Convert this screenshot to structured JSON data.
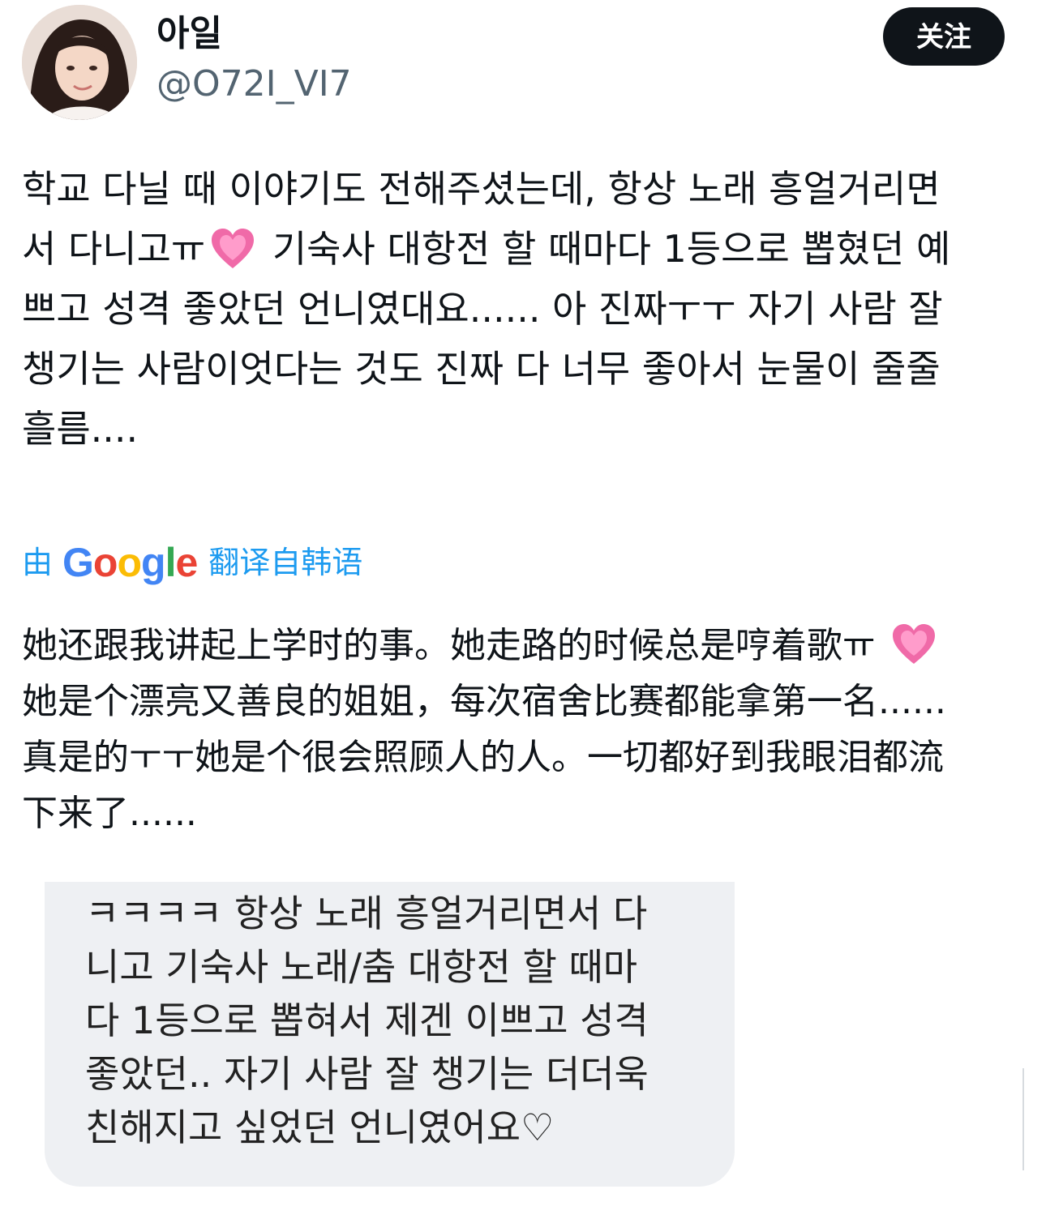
{
  "author": {
    "display_name": "아일",
    "handle": "@O72I_VI7"
  },
  "follow_button": {
    "label": "关注"
  },
  "tweet": {
    "original_lines": [
      "학교 다닐 때 이야기도 전해주셨는데, 항상 노래 흥얼거리면",
      "서 다니고ㅠ",
      " 기숙사 대항전 할 때마다 1등으로 뽑혔던 예",
      "쁘고 성격 좋았던 언니였대요...... 아 진짜ㅜㅜ 자기 사람 잘",
      "챙기는 사람이엇다는 것도 진짜 다 너무 좋아서 눈물이 줄줄",
      "흘름...."
    ],
    "translation_label": {
      "prefix": "由",
      "google_letters": [
        "G",
        "o",
        "o",
        "g",
        "l",
        "e"
      ],
      "suffix": "翻译自韩语"
    },
    "translated_lines": [
      "她还跟我讲起上学时的事。她走路的时候总是哼着歌ㅠ ",
      "她是个漂亮又善良的姐姐，每次宿舍比赛都能拿第一名......",
      "真是的ㅜㅜ她是个很会照顾人的人。一切都好到我眼泪都流",
      "下来了......"
    ],
    "emoji_icon": "growing-heart-icon"
  },
  "media": {
    "lines": [
      "ㅋㅋㅋㅋ 항상 노래 흥얼거리면서 다",
      "니고 기숙사 노래/춤 대항전 할 때마",
      "다 1등으로 뽑혀서 제겐 이쁘고 성격",
      "좋았던..  자기 사람 잘 챙기는 더더욱",
      "친해지고 싶었던 언니였어요♡"
    ]
  },
  "colors": {
    "text": "#0f1419",
    "secondary": "#536471",
    "link": "#1d9bf0",
    "heart": "#f06aa8",
    "media_bg": "#eef0f3"
  }
}
